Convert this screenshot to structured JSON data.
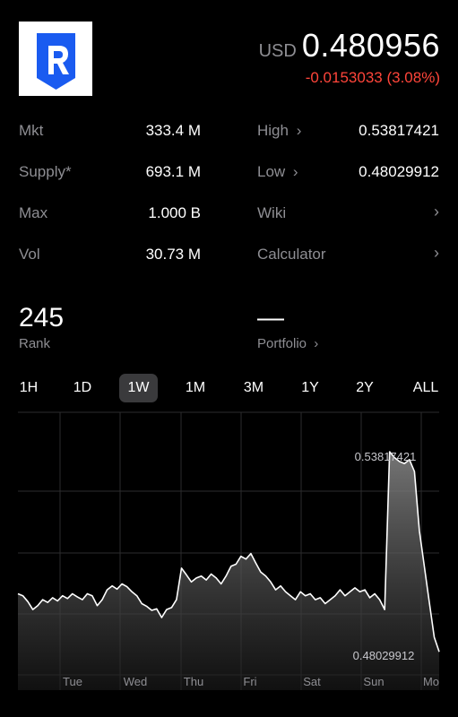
{
  "logo": {
    "icon": "ren-logo",
    "color": "#1a5bf0"
  },
  "header": {
    "currency": "USD",
    "price": "0.480956",
    "change": "-0.0153033 (3.08%)",
    "change_color": "#ff453a"
  },
  "stats": {
    "mkt_label": "Mkt",
    "mkt_value": "333.4 M",
    "supply_label": "Supply*",
    "supply_value": "693.1 M",
    "max_label": "Max",
    "max_value": "1.000 B",
    "vol_label": "Vol",
    "vol_value": "30.73 M",
    "high_label": "High",
    "high_value": "0.53817421",
    "low_label": "Low",
    "low_value": "0.48029912",
    "wiki_label": "Wiki",
    "calculator_label": "Calculator"
  },
  "rank": {
    "value": "245",
    "label": "Rank"
  },
  "portfolio": {
    "value": "—",
    "label": "Portfolio"
  },
  "ranges": {
    "items": [
      "1H",
      "1D",
      "1W",
      "1M",
      "3M",
      "1Y",
      "2Y",
      "ALL"
    ],
    "selected": "1W"
  },
  "chart_data": {
    "type": "area",
    "x_labels": [
      "Tue",
      "Wed",
      "Thu",
      "Fri",
      "Sat",
      "Sun",
      "Mo"
    ],
    "high_label": "0.53817421",
    "low_label": "0.48029912",
    "y_range": [
      0.478,
      0.545
    ],
    "series": [
      {
        "values": [
          0.499,
          0.4985,
          0.497,
          0.495,
          0.496,
          0.4975,
          0.4968,
          0.498,
          0.4972,
          0.4985,
          0.4978,
          0.499,
          0.4982,
          0.4975,
          0.499,
          0.4985,
          0.496,
          0.4975,
          0.5,
          0.501,
          0.5002,
          0.5015,
          0.5008,
          0.4995,
          0.4985,
          0.4965,
          0.4958,
          0.4948,
          0.4952,
          0.493,
          0.495,
          0.4955,
          0.4975,
          0.5055,
          0.5038,
          0.502,
          0.503,
          0.5035,
          0.5025,
          0.504,
          0.503,
          0.5015,
          0.5035,
          0.506,
          0.5065,
          0.5085,
          0.5078,
          0.5092,
          0.5068,
          0.5045,
          0.5035,
          0.502,
          0.5,
          0.501,
          0.4995,
          0.4985,
          0.4975,
          0.4995,
          0.4985,
          0.499,
          0.4975,
          0.498,
          0.4965,
          0.4975,
          0.4985,
          0.5,
          0.4985,
          0.4995,
          0.5005,
          0.4995,
          0.5,
          0.498,
          0.499,
          0.4975,
          0.495,
          0.535,
          0.5335,
          0.5325,
          0.532,
          0.533,
          0.53,
          0.515,
          0.506,
          0.497,
          0.488,
          0.4843
        ]
      }
    ]
  }
}
